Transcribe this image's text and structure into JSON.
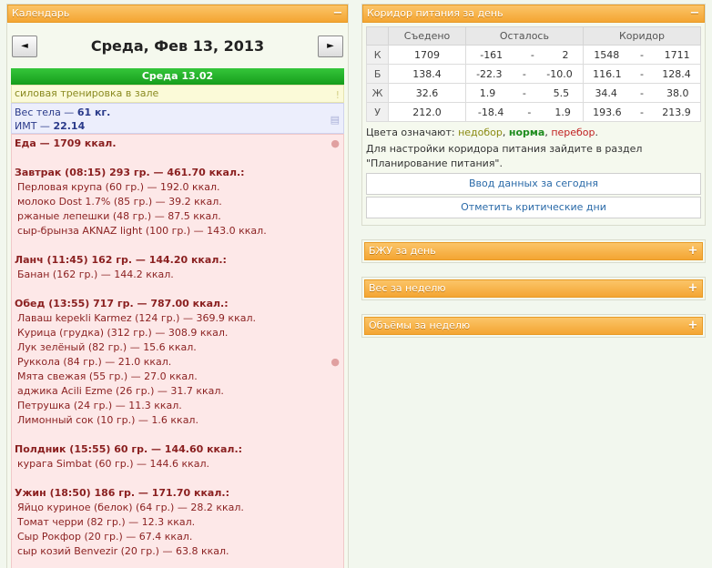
{
  "calendar": {
    "title": "Календарь",
    "prev": "◄",
    "next": "►",
    "date_title": "Среда, Фев 13, 2013",
    "day_header": "Среда 13.02",
    "training": "силовая тренировка в зале",
    "weight_label": "Вес тела — ",
    "weight_value": "61 кг.",
    "bmi_label": "ИМТ — ",
    "bmi_value": "22.14",
    "food_total": "Еда — 1709 ккал.",
    "meals": [
      {
        "header": "Завтрак (08:15) 293 гр. — 461.70 ккал.:",
        "items": [
          "Перловая крупа (60 гр.) — 192.0 ккал.",
          "молоко Dost 1.7% (85 гр.) — 39.2 ккал.",
          "ржаные лепешки (48 гр.) — 87.5 ккал.",
          "сыр-брынза AKNAZ light (100 гр.) — 143.0 ккал."
        ]
      },
      {
        "header": "Ланч (11:45) 162 гр. — 144.20 ккал.:",
        "items": [
          "Банан (162 гр.) — 144.2 ккал."
        ]
      },
      {
        "header": "Обед (13:55) 717 гр. — 787.00 ккал.:",
        "items": [
          "Лаваш kepekli Karmez (124 гр.) — 369.9 ккал.",
          "Курица (грудка) (312 гр.) — 308.9 ккал.",
          "Лук зелёный (82 гр.) — 15.6 ккал.",
          "Руккола (84 гр.) — 21.0 ккал.",
          "Мята свежая (55 гр.) — 27.0 ккал.",
          "аджика Acili Ezme (26 гр.) — 31.7 ккал.",
          "Петрушка (24 гр.) — 11.3 ккал.",
          "Лимонный сок (10 гр.) — 1.6 ккал."
        ]
      },
      {
        "header": "Полдник (15:55) 60 гр. — 144.60 ккал.:",
        "items": [
          "курага Simbat (60 гр.) — 144.6 ккал."
        ]
      },
      {
        "header": "Ужин (18:50) 186 гр. — 171.70 ккал.:",
        "items": [
          "Яйцо куриное (белок) (64 гр.) — 28.2 ккал.",
          "Томат черри (82 гр.) — 12.3 ккал.",
          "Сыр Рокфор (20 гр.) — 67.4 ккал.",
          "сыр козий Benvezir (20 гр.) — 63.8 ккал."
        ]
      }
    ]
  },
  "corridor": {
    "title": "Коридор питания за день",
    "headers": [
      "",
      "Съедено",
      "Осталось",
      "Коридор"
    ],
    "rows": [
      {
        "label": "К",
        "eaten": "1709",
        "rem_a": "-161",
        "rem_b": "2",
        "cor_a": "1548",
        "cor_b": "1711",
        "cls": "g"
      },
      {
        "label": "Б",
        "eaten": "138.4",
        "rem_a": "-22.3",
        "rem_b": "-10.0",
        "cor_a": "116.1",
        "cor_b": "128.4",
        "cls": "r"
      },
      {
        "label": "Ж",
        "eaten": "32.6",
        "rem_a": "1.9",
        "rem_b": "5.5",
        "cor_a": "34.4",
        "cor_b": "38.0",
        "cls": "y"
      },
      {
        "label": "У",
        "eaten": "212.0",
        "rem_a": "-18.4",
        "rem_b": "1.9",
        "cor_a": "193.6",
        "cor_b": "213.9",
        "cls": "g"
      }
    ],
    "dash": "-",
    "legend_prefix": "Цвета означают: ",
    "legend_under": "недобор",
    "legend_norm": "норма",
    "legend_over": "перебор",
    "sep": ", ",
    "dot": ".",
    "info": "Для настройки коридора питания зайдите в раздел \"Планирование питания\".",
    "btn_input": "Ввод данных за сегодня",
    "btn_critical": "Отметить критические дни"
  },
  "collapsed": {
    "bju": "БЖУ за день",
    "weight_week": "Вес за неделю",
    "volumes_week": "Объёмы за неделю"
  },
  "icons": {
    "collapse": "−",
    "expand": "+"
  }
}
